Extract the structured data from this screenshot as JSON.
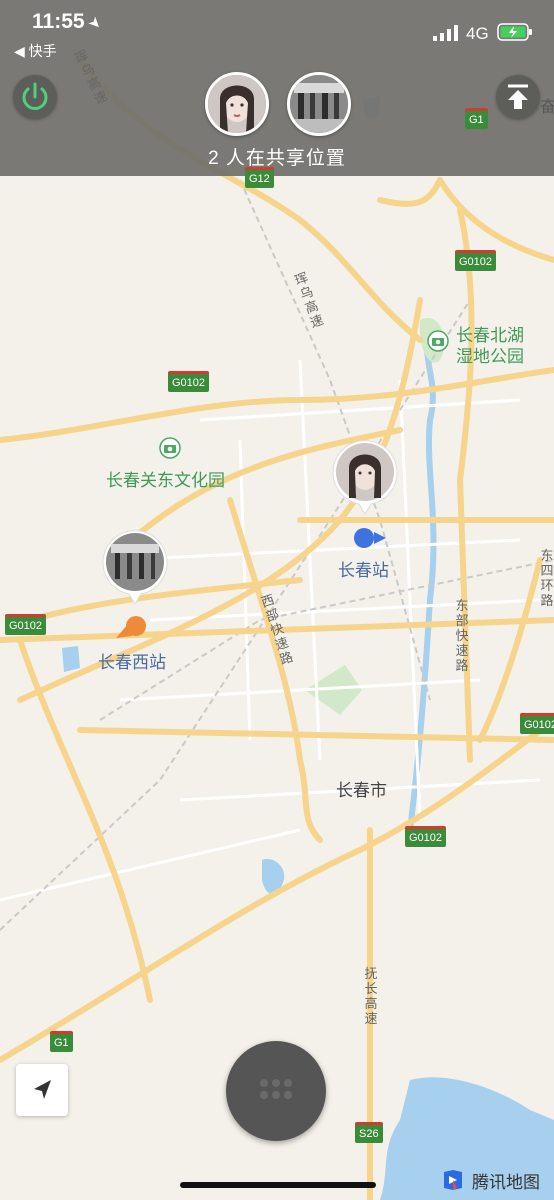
{
  "status_bar": {
    "time": "11:55",
    "back_label": "◀ 快手",
    "network": "4G"
  },
  "header": {
    "sharing_text": "2 人在共享位置"
  },
  "map_labels": {
    "changchun_station": "长春站",
    "changchun_west_station": "长春西站",
    "changchun_city": "长春市",
    "guandong_park": "长春关东文化园",
    "north_lake_park_line1": "长春北湖",
    "north_lake_park_line2": "湿地公园"
  },
  "road_names": {
    "hunwu_top": "珲乌高速",
    "hunwu_mid": "珲乌高速",
    "west_expressway": "西部快速路",
    "east_expressway": "东部快速路",
    "east_ring": "东四环路",
    "fuchang": "抚长高速",
    "edge": "奋"
  },
  "shields": {
    "g1_top": "G1",
    "g12": "G12",
    "g0102_ne": "G0102",
    "g0102_w": "G0102",
    "g0102_left": "G0102",
    "g0102_right": "G0102",
    "g0102_s": "G0102",
    "g1_bottom": "G1",
    "s26": "S26"
  },
  "brand": {
    "name": "腾讯地图"
  },
  "colors": {
    "road": "#f5d58e",
    "water": "#9ec9ea",
    "park": "#c8e2c0",
    "user_blue": "#3d73e0",
    "user_orange": "#ee8b3a"
  }
}
